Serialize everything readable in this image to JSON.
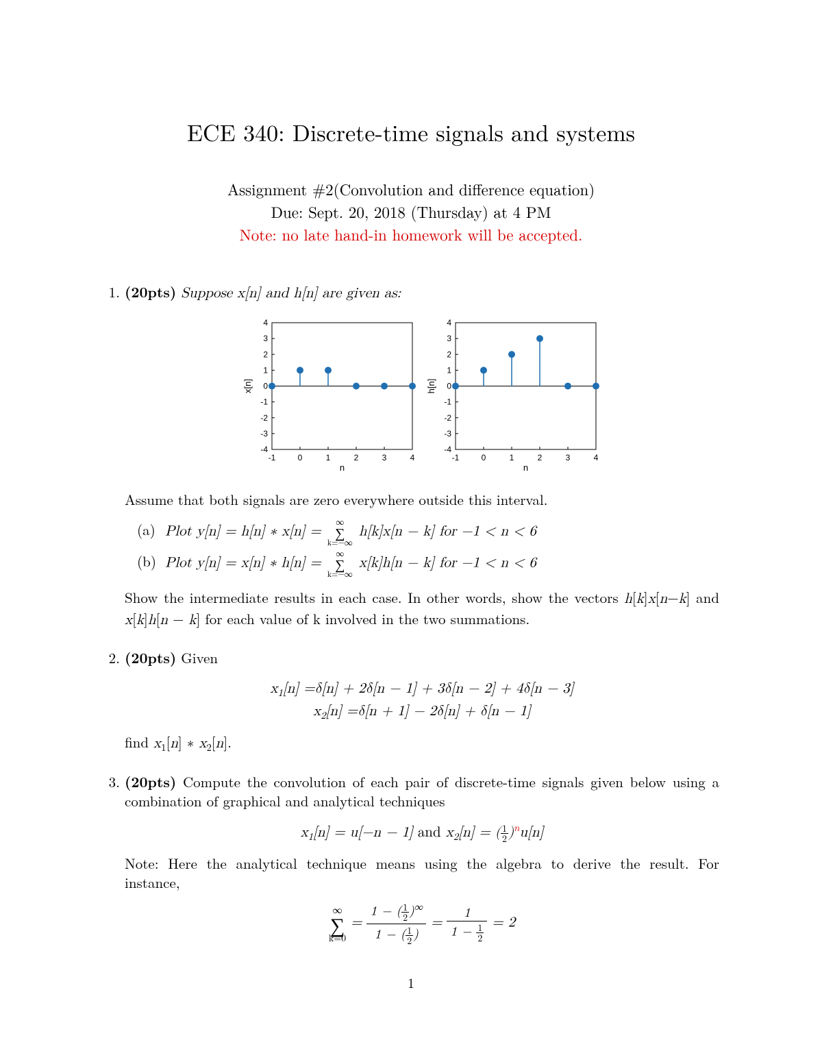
{
  "title": "ECE 340: Discrete-time signals and systems",
  "subtitle": {
    "line1": "Assignment #2(Convolution and difference equation)",
    "line2": "Due: Sept. 20, 2018 (Thursday) at 4 PM",
    "line3": "Note: no late hand-in homework will be accepted."
  },
  "p1": {
    "pts": "(20pts)",
    "intro": " Suppose x[n] and h[n] are given as:",
    "assume": "Assume that both signals are zero everywhere outside this interval.",
    "a_lbl": "(a)",
    "a_txt": "Plot y[n] = h[n] ∗ x[n] = ",
    "a_sum_up": "∞",
    "a_sum_dn": "k=−∞",
    "a_tail": " h[k]x[n − k] for −1 < n < 6",
    "b_lbl": "(b)",
    "b_txt": "Plot y[n] = x[n] ∗ h[n] = ",
    "b_sum_up": "∞",
    "b_sum_dn": "k=−∞",
    "b_tail": " x[k]h[n − k] for −1 < n < 6",
    "show": "Show the intermediate results in each case. In other words, show the vectors h[k]x[n−k] and x[k]h[n − k] for each value of k involved in the two summations."
  },
  "p2": {
    "pts": "(20pts)",
    "intro": " Given",
    "eq1": "x₁[n] = δ[n] + 2δ[n − 1] + 3δ[n − 2] + 4δ[n − 3]",
    "eq2": "x₂[n] = δ[n + 1] − 2δ[n] + δ[n − 1]",
    "find": "find x₁[n] ∗ x₂[n]."
  },
  "p3": {
    "pts": "(20pts)",
    "intro": " Compute the convolution of each pair of discrete-time signals given below using a combination of graphical and analytical techniques",
    "eq_pre": "x₁[n] = u[−n − 1] and x₂[n] = (",
    "eq_half_n": "1",
    "eq_half_d": "2",
    "eq_exp": "n",
    "eq_post": "u[n]",
    "note": "Note: Here the analytical technique means using the algebra to derive the result. For instance,",
    "s_up": "∞",
    "s_dn": "k=0",
    "f1n": "1 − (½)∞",
    "f1d": "1 − (½)",
    "f2n": "1",
    "f2d": "1 − ½",
    "res": " = 2"
  },
  "pageno": "1",
  "chart_data": [
    {
      "type": "stem",
      "title": "",
      "xlabel": "n",
      "ylabel": "x[n]",
      "xlim": [
        -1,
        4
      ],
      "ylim": [
        -4,
        4
      ],
      "xticks": [
        -1,
        0,
        1,
        2,
        3,
        4
      ],
      "yticks": [
        -4,
        -3,
        -2,
        -1,
        0,
        1,
        2,
        3,
        4
      ],
      "points": [
        {
          "n": -1,
          "v": 0
        },
        {
          "n": 0,
          "v": 1
        },
        {
          "n": 1,
          "v": 1
        },
        {
          "n": 2,
          "v": 0
        },
        {
          "n": 3,
          "v": 0
        },
        {
          "n": 4,
          "v": 0
        }
      ]
    },
    {
      "type": "stem",
      "title": "",
      "xlabel": "n",
      "ylabel": "h[n]",
      "xlim": [
        -1,
        4
      ],
      "ylim": [
        -4,
        4
      ],
      "xticks": [
        -1,
        0,
        1,
        2,
        3,
        4
      ],
      "yticks": [
        -4,
        -3,
        -2,
        -1,
        0,
        1,
        2,
        3,
        4
      ],
      "points": [
        {
          "n": -1,
          "v": 0
        },
        {
          "n": 0,
          "v": 1
        },
        {
          "n": 1,
          "v": 2
        },
        {
          "n": 2,
          "v": 3
        },
        {
          "n": 3,
          "v": 0
        },
        {
          "n": 4,
          "v": 0
        }
      ]
    }
  ]
}
